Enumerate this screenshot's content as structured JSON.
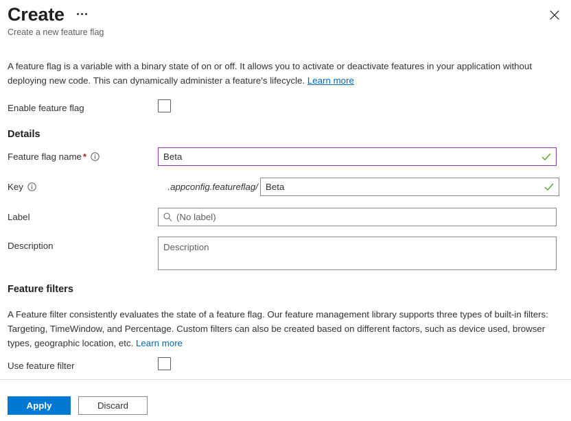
{
  "header": {
    "title": "Create",
    "subtitle": "Create a new feature flag",
    "more_menu": "…",
    "close": "Close",
    "more_icon": "ellipsis-icon",
    "close_icon": "close-icon"
  },
  "intro": {
    "text": "A feature flag is a variable with a binary state of on or off. It allows you to activate or deactivate features in your application without deploying new code. This can dynamically administer a feature's lifecycle. ",
    "link": "Learn more"
  },
  "enable": {
    "label": "Enable feature flag",
    "checked": false
  },
  "details": {
    "heading": "Details",
    "name": {
      "label": "Feature flag name",
      "required_mark": "*",
      "value": "Beta",
      "valid": true,
      "info_icon": "info-icon"
    },
    "key": {
      "label": "Key",
      "prefix": ".appconfig.featureflag/",
      "value": "Beta",
      "valid": true,
      "info_icon": "info-icon"
    },
    "label_field": {
      "label": "Label",
      "value": "",
      "placeholder": "(No label)",
      "search_icon": "search-icon"
    },
    "description": {
      "label": "Description",
      "value": "",
      "placeholder": "Description"
    }
  },
  "filters": {
    "heading": "Feature filters",
    "text": "A Feature filter consistently evaluates the state of a feature flag. Our feature management library supports three types of built-in filters: Targeting, TimeWindow, and Percentage. Custom filters can also be created based on different factors, such as device used, browser types, geographic location, etc. ",
    "link": "Learn more",
    "use_filter_label": "Use feature filter",
    "use_filter_checked": false
  },
  "footer": {
    "apply": "Apply",
    "discard": "Discard"
  },
  "colors": {
    "accent": "#0078d4",
    "link": "#0067b8",
    "focus_border": "#8a3ab0",
    "valid_check": "#5da83b",
    "required": "#a4262c"
  }
}
